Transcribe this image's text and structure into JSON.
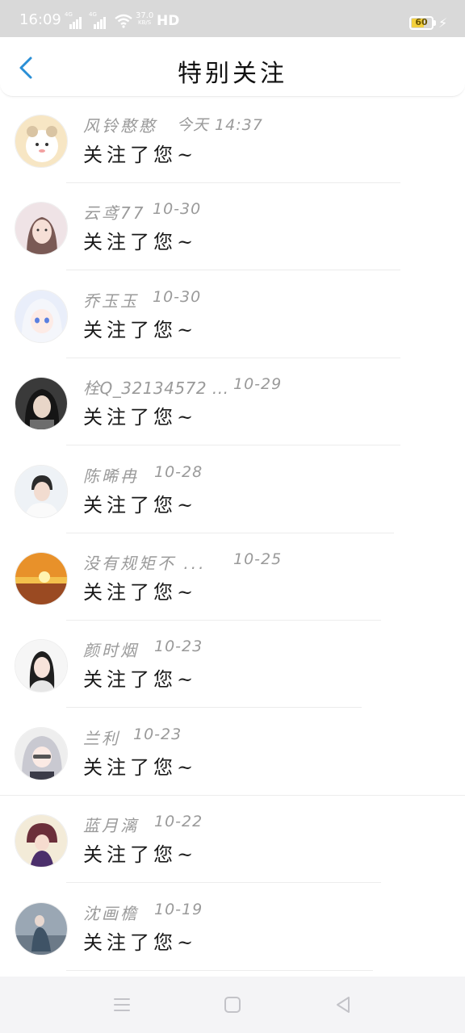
{
  "status_bar": {
    "time": "16:09",
    "signal1_label": "4G",
    "signal2_label": "4G",
    "net_speed_value": "37.0",
    "net_speed_unit": "KB/S",
    "hd_label": "HD",
    "battery_level": "60",
    "icons": [
      "signal-icon",
      "signal-icon",
      "wifi-icon",
      "battery-icon",
      "charging-icon"
    ]
  },
  "header": {
    "title": "特别关注",
    "back_icon": "chevron-left-icon"
  },
  "list": {
    "items": [
      {
        "name": "风铃憨憨",
        "time": "今天 14:37",
        "message": "关注了您~"
      },
      {
        "name": "云鸢77",
        "time": "10-30",
        "message": "关注了您~"
      },
      {
        "name": "乔玉玉",
        "time": "10-30",
        "message": "关注了您~"
      },
      {
        "name": "栓Q_32134572 ...",
        "time": "10-29",
        "message": "关注了您~"
      },
      {
        "name": "陈晞冉",
        "time": "10-28",
        "message": "关注了您~"
      },
      {
        "name": "没有规矩不 ...",
        "time": "10-25",
        "message": "关注了您~"
      },
      {
        "name": "颜时烟",
        "time": "10-23",
        "message": "关注了您~"
      },
      {
        "name": "兰利",
        "time": "10-23",
        "message": "关注了您~"
      },
      {
        "name": "蓝月漓",
        "time": "10-22",
        "message": "关注了您~"
      },
      {
        "name": "沈画檐",
        "time": "10-19",
        "message": "关注了您~"
      }
    ]
  },
  "nav_bar": {
    "icons": [
      "menu-icon",
      "home-square-icon",
      "back-triangle-icon"
    ]
  },
  "colors": {
    "accent": "#2a8fd6",
    "status_bar_bg": "#d9d9d9",
    "secondary_text": "#9a9a9a",
    "battery_fill": "#f3d03e"
  }
}
